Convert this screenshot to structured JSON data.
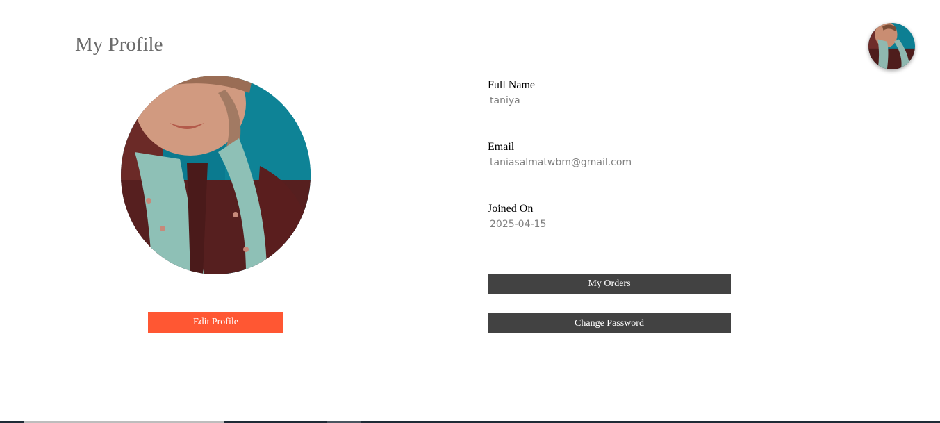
{
  "page": {
    "title": "My Profile"
  },
  "profile": {
    "full_name_label": "Full Name",
    "full_name_value": "taniya",
    "email_label": "Email",
    "email_value": "taniasalmatwbm@gmail.com",
    "joined_label": "Joined On",
    "joined_value": "2025-04-15"
  },
  "actions": {
    "edit_profile_label": "Edit Profile",
    "my_orders_label": "My Orders",
    "change_password_label": "Change Password"
  },
  "colors": {
    "accent": "#ff5733",
    "dark_button": "#424242",
    "title": "#6b6b6b",
    "value_text": "#808080"
  },
  "icons": {
    "header_avatar": "user-avatar",
    "profile_photo": "profile-photo"
  }
}
